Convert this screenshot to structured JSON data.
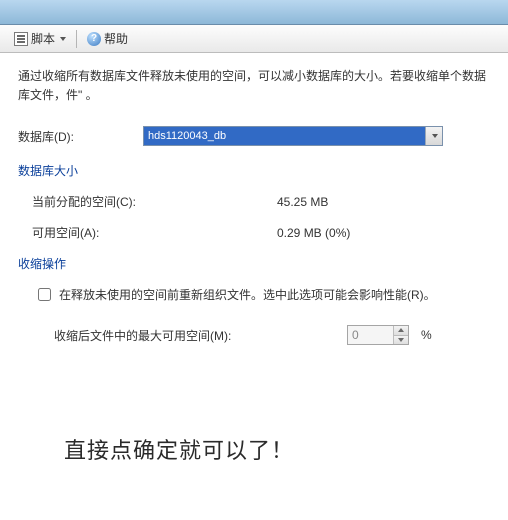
{
  "toolbar": {
    "script_label": "脚本",
    "help_label": "帮助"
  },
  "intro": "通过收缩所有数据库文件释放未使用的空间，可以减小数据库的大小。若要收缩单个数据库文件，件\" 。",
  "form": {
    "database_label": "数据库(D):",
    "database_value": "hds1120043_db"
  },
  "size_section": {
    "header": "数据库大小",
    "allocated_label": "当前分配的空间(C):",
    "allocated_value": "45.25 MB",
    "available_label": "可用空间(A):",
    "available_value": "0.29 MB (0%)"
  },
  "shrink_section": {
    "header": "收缩操作",
    "reorganize_label": "在释放未使用的空间前重新组织文件。选中此选项可能会影响性能(R)。",
    "max_space_label": "收缩后文件中的最大可用空间(M):",
    "max_space_value": "0",
    "pct_symbol": "%"
  },
  "annotation": "直接点确定就可以了！"
}
